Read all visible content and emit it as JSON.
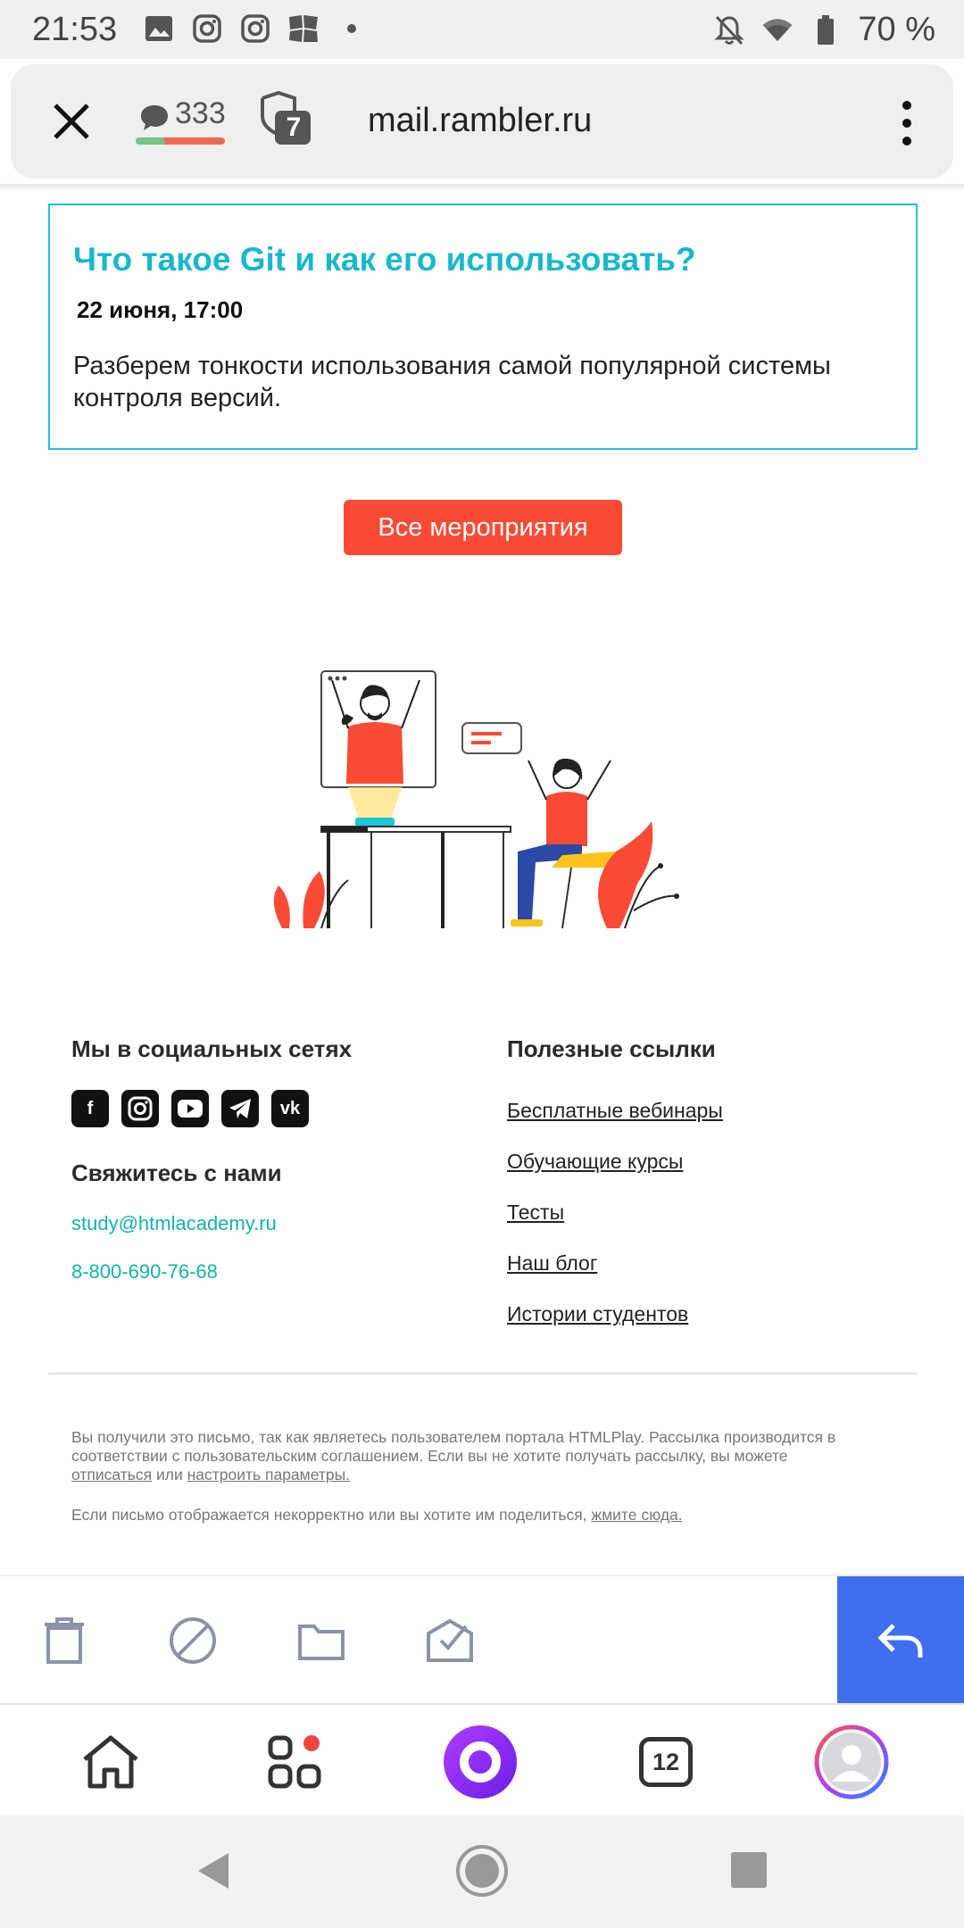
{
  "status_bar": {
    "time": "21:53",
    "battery": "70 %",
    "icons_left": [
      "image-icon",
      "instagram-icon",
      "instagram-icon",
      "photo-app-icon",
      "dot-icon"
    ],
    "icons_right": [
      "notifications-off-icon",
      "wifi-icon",
      "battery-icon"
    ]
  },
  "browser": {
    "chat_count": "333",
    "shield_count": "7",
    "url": "mail.rambler.ru"
  },
  "email": {
    "event": {
      "title": "Что такое Git и как его использовать?",
      "date": "22 июня, 17:00",
      "description": "Разберем тонкости использования самой популярной системы контроля версий."
    },
    "all_events_button": "Все мероприятия",
    "footer": {
      "social_heading": "Мы в социальных сетях",
      "social_icons": [
        "facebook-icon",
        "instagram-icon",
        "youtube-icon",
        "telegram-icon",
        "vk-icon"
      ],
      "contact_heading": "Свяжитесь с нами",
      "email": "study@htmlacademy.ru",
      "phone": "8-800-690-76-68",
      "useful_heading": "Полезные ссылки",
      "useful_links": [
        "Бесплатные вебинары",
        "Обучающие курсы",
        "Тесты",
        "Наш блог",
        "Истории студентов"
      ],
      "note_text": "Вы получили это письмо, так как являетесь пользователем портала HTMLPlay. Рассылка производится в соответствии с пользовательским соглашением. Если вы не хотите получать рассылку, вы можете",
      "unsubscribe": "отписаться",
      "or": "или",
      "settings": "настроить параметры.",
      "note2_text": "Если письмо отображается некорректно или вы хотите им поделиться,",
      "click_here": "жмите сюда."
    }
  },
  "action_bar": {
    "actions": [
      "delete-icon",
      "spam-icon",
      "move-to-folder-icon",
      "mark-read-icon",
      "reply-icon"
    ]
  },
  "app_nav": {
    "tabs_count": "12",
    "items": [
      "home-icon",
      "services-icon",
      "alice-icon",
      "tabs-icon",
      "profile-icon"
    ],
    "accent": "#8a2cf0"
  },
  "colors": {
    "accent_cyan": "#18b8cc",
    "button_red": "#fb4a34",
    "link_teal": "#16b3a7",
    "reply_blue": "#3f6ff0"
  }
}
